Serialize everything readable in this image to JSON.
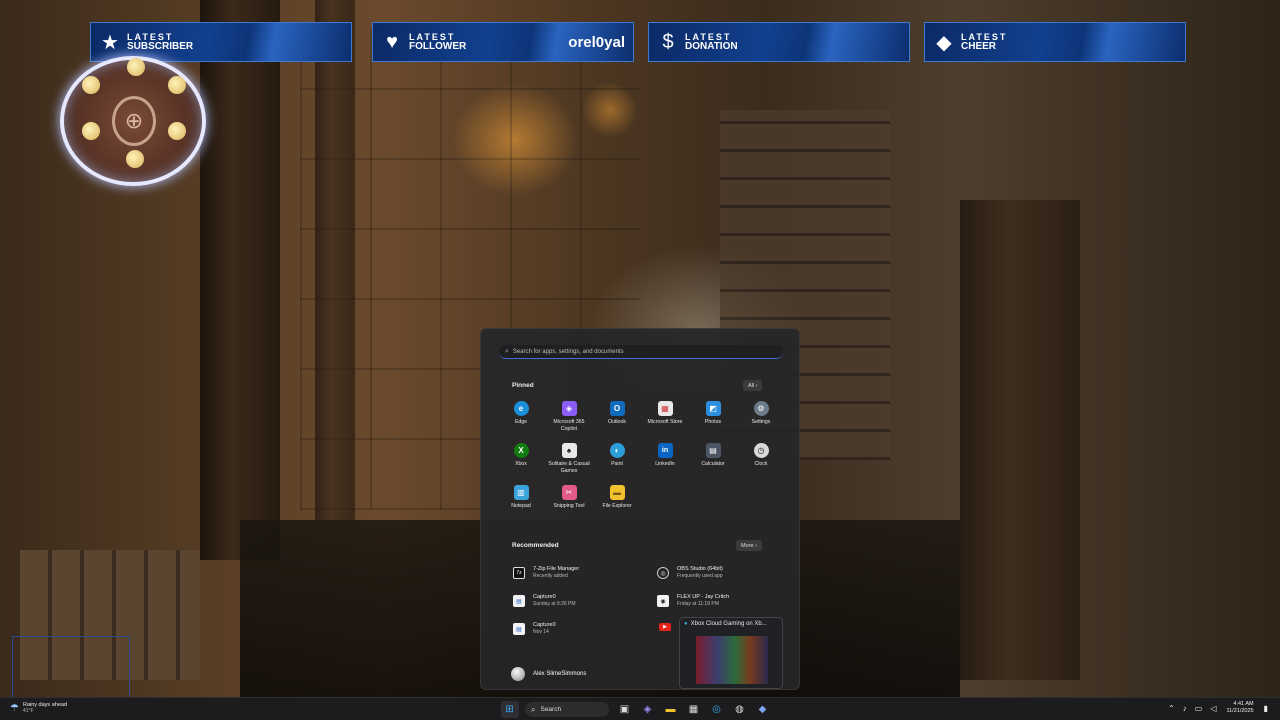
{
  "overlay": {
    "alerts": [
      {
        "top": "LATEST",
        "bottom": "SUBSCRIBER",
        "value": "",
        "icon": "★"
      },
      {
        "top": "LATEST",
        "bottom": "FOLLOWER",
        "value": "orel0yal",
        "icon": "♥"
      },
      {
        "top": "LATEST",
        "bottom": "DONATION",
        "value": "",
        "icon": "$"
      },
      {
        "top": "LATEST",
        "bottom": "CHEER",
        "value": "",
        "icon": "◆"
      }
    ]
  },
  "start_menu": {
    "search_placeholder": "Search for apps, settings, and documents",
    "pinned_title": "Pinned",
    "all_label": "All ›",
    "pinned": [
      {
        "label": "Edge",
        "icon": "e",
        "color": "#1b8fd8"
      },
      {
        "label": "Microsoft 365 Copilot",
        "icon": "◈",
        "color": "#8b5cf6"
      },
      {
        "label": "Outlook",
        "icon": "O",
        "color": "#0f6cbd"
      },
      {
        "label": "Microsoft Store",
        "icon": "▦",
        "color": "#e8e8e8"
      },
      {
        "label": "Photos",
        "icon": "◩",
        "color": "#2d8fe0"
      },
      {
        "label": "Settings",
        "icon": "⚙",
        "color": "#6c7a89"
      },
      {
        "label": "Xbox",
        "icon": "X",
        "color": "#107c10"
      },
      {
        "label": "Solitaire & Casual Games",
        "icon": "♠",
        "color": "#e8e8e8"
      },
      {
        "label": "Paint",
        "icon": "◐",
        "color": "#2b9fd9"
      },
      {
        "label": "LinkedIn",
        "icon": "in",
        "color": "#0a66c2"
      },
      {
        "label": "Calculator",
        "icon": "▤",
        "color": "#4b5563"
      },
      {
        "label": "Clock",
        "icon": "◷",
        "color": "#d9d9d9"
      },
      {
        "label": "Notepad",
        "icon": "▥",
        "color": "#3aa3d9"
      },
      {
        "label": "Snipping Tool",
        "icon": "✂",
        "color": "#e05a8a"
      },
      {
        "label": "File Explorer",
        "icon": "▬",
        "color": "#f2c12e"
      }
    ],
    "recommended_title": "Recommended",
    "more_label": "More ›",
    "recommended": [
      {
        "name": "7-Zip File Manager",
        "sub": "Recently added",
        "icon": "7z"
      },
      {
        "name": "OBS Studio (64bit)",
        "sub": "Frequently used app",
        "icon": "◎"
      },
      {
        "name": "Capture0",
        "sub": "Sunday at 9:26 PM",
        "icon": "▤"
      },
      {
        "name": "FLEX UP - Jay Critch",
        "sub": "Friday at 11:18 PM",
        "icon": "◉"
      },
      {
        "name": "Capture0",
        "sub": "Nov 14",
        "icon": "▤"
      }
    ],
    "preview_title": "Xbox Cloud Gaming on Xb...",
    "user_name": "Alex SlimeSimmons"
  },
  "taskbar": {
    "weather_main": "Rainy days ahead",
    "weather_sub": "41°F",
    "search_label": "Search",
    "time": "4:41 AM",
    "date": "11/21/2025"
  }
}
